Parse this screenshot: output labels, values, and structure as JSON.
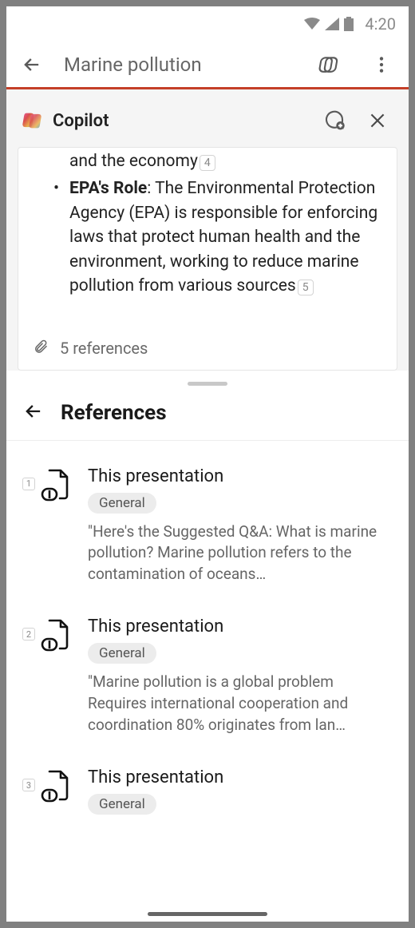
{
  "status_bar": {
    "time": "4:20"
  },
  "header": {
    "title": "Marine pollution"
  },
  "copilot": {
    "title": "Copilot",
    "top_fragment": "and the economy",
    "top_cite": "4",
    "bullet_bold": "EPA's Role",
    "bullet_text": ": The Environmental Protection Agency (EPA) is responsible for enforcing laws that protect human health and the environment, working to reduce marine pollution from various sources",
    "bullet_cite": "5",
    "ref_count_text": "5 references"
  },
  "references_panel": {
    "title": "References",
    "items": [
      {
        "num": "1",
        "title": "This presentation",
        "tag": "General",
        "snippet": "\"Here's the Suggested Q&A:   What is marine pollution?   Marine pollution refers to the contamination of oceans…"
      },
      {
        "num": "2",
        "title": "This presentation",
        "tag": "General",
        "snippet": "\"Marine pollution is a global problem Requires international cooperation and coordination 80% originates from lan…"
      },
      {
        "num": "3",
        "title": "This presentation",
        "tag": "General",
        "snippet": ""
      }
    ]
  }
}
